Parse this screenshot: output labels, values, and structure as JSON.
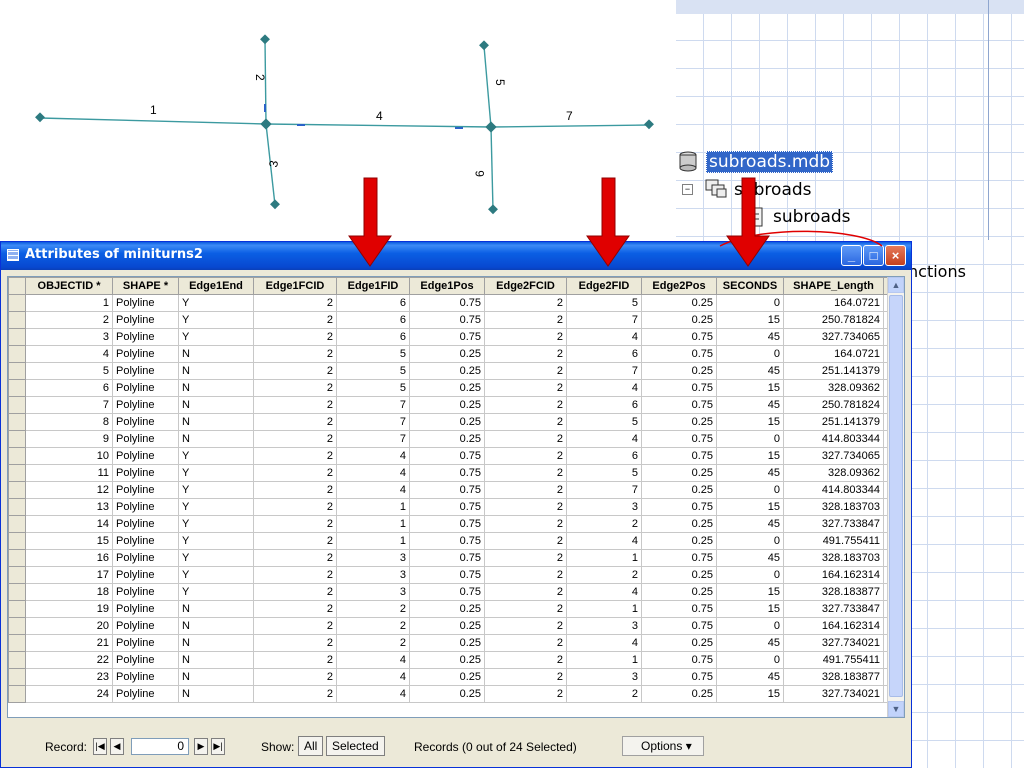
{
  "map": {
    "segment_labels": [
      "1",
      "2",
      "3",
      "4",
      "5",
      "6",
      "7"
    ]
  },
  "catalog": {
    "database": "subroads.mdb",
    "dataset": "subroads",
    "feature_class": "subroads",
    "partial_text": "nctions"
  },
  "window": {
    "title": "Attributes of miniturns2",
    "columns": [
      "OBJECTID *",
      "SHAPE *",
      "Edge1End",
      "Edge1FCID",
      "Edge1FID",
      "Edge1Pos",
      "Edge2FCID",
      "Edge2FID",
      "Edge2Pos",
      "SECONDS",
      "SHAPE_Length"
    ],
    "rows": [
      [
        "1",
        "Polyline",
        "Y",
        "2",
        "6",
        "0.75",
        "2",
        "5",
        "0.25",
        "0",
        "164.0721"
      ],
      [
        "2",
        "Polyline",
        "Y",
        "2",
        "6",
        "0.75",
        "2",
        "7",
        "0.25",
        "15",
        "250.781824"
      ],
      [
        "3",
        "Polyline",
        "Y",
        "2",
        "6",
        "0.75",
        "2",
        "4",
        "0.75",
        "45",
        "327.734065"
      ],
      [
        "4",
        "Polyline",
        "N",
        "2",
        "5",
        "0.25",
        "2",
        "6",
        "0.75",
        "0",
        "164.0721"
      ],
      [
        "5",
        "Polyline",
        "N",
        "2",
        "5",
        "0.25",
        "2",
        "7",
        "0.25",
        "45",
        "251.141379"
      ],
      [
        "6",
        "Polyline",
        "N",
        "2",
        "5",
        "0.25",
        "2",
        "4",
        "0.75",
        "15",
        "328.09362"
      ],
      [
        "7",
        "Polyline",
        "N",
        "2",
        "7",
        "0.25",
        "2",
        "6",
        "0.75",
        "45",
        "250.781824"
      ],
      [
        "8",
        "Polyline",
        "N",
        "2",
        "7",
        "0.25",
        "2",
        "5",
        "0.25",
        "15",
        "251.141379"
      ],
      [
        "9",
        "Polyline",
        "N",
        "2",
        "7",
        "0.25",
        "2",
        "4",
        "0.75",
        "0",
        "414.803344"
      ],
      [
        "10",
        "Polyline",
        "Y",
        "2",
        "4",
        "0.75",
        "2",
        "6",
        "0.75",
        "15",
        "327.734065"
      ],
      [
        "11",
        "Polyline",
        "Y",
        "2",
        "4",
        "0.75",
        "2",
        "5",
        "0.25",
        "45",
        "328.09362"
      ],
      [
        "12",
        "Polyline",
        "Y",
        "2",
        "4",
        "0.75",
        "2",
        "7",
        "0.25",
        "0",
        "414.803344"
      ],
      [
        "13",
        "Polyline",
        "Y",
        "2",
        "1",
        "0.75",
        "2",
        "3",
        "0.75",
        "15",
        "328.183703"
      ],
      [
        "14",
        "Polyline",
        "Y",
        "2",
        "1",
        "0.75",
        "2",
        "2",
        "0.25",
        "45",
        "327.733847"
      ],
      [
        "15",
        "Polyline",
        "Y",
        "2",
        "1",
        "0.75",
        "2",
        "4",
        "0.25",
        "0",
        "491.755411"
      ],
      [
        "16",
        "Polyline",
        "Y",
        "2",
        "3",
        "0.75",
        "2",
        "1",
        "0.75",
        "45",
        "328.183703"
      ],
      [
        "17",
        "Polyline",
        "Y",
        "2",
        "3",
        "0.75",
        "2",
        "2",
        "0.25",
        "0",
        "164.162314"
      ],
      [
        "18",
        "Polyline",
        "Y",
        "2",
        "3",
        "0.75",
        "2",
        "4",
        "0.25",
        "15",
        "328.183877"
      ],
      [
        "19",
        "Polyline",
        "N",
        "2",
        "2",
        "0.25",
        "2",
        "1",
        "0.75",
        "15",
        "327.733847"
      ],
      [
        "20",
        "Polyline",
        "N",
        "2",
        "2",
        "0.25",
        "2",
        "3",
        "0.75",
        "0",
        "164.162314"
      ],
      [
        "21",
        "Polyline",
        "N",
        "2",
        "2",
        "0.25",
        "2",
        "4",
        "0.25",
        "45",
        "327.734021"
      ],
      [
        "22",
        "Polyline",
        "N",
        "2",
        "4",
        "0.25",
        "2",
        "1",
        "0.75",
        "0",
        "491.755411"
      ],
      [
        "23",
        "Polyline",
        "N",
        "2",
        "4",
        "0.25",
        "2",
        "3",
        "0.75",
        "45",
        "328.183877"
      ],
      [
        "24",
        "Polyline",
        "N",
        "2",
        "4",
        "0.25",
        "2",
        "2",
        "0.25",
        "15",
        "327.734021"
      ]
    ],
    "record_label": "Record:",
    "record_value": "0",
    "show_label": "Show:",
    "show_all": "All",
    "show_selected": "Selected",
    "records_status": "Records (0 out of 24 Selected)",
    "options_label": "Options"
  },
  "colors": {
    "title_bar": "#0b5fe4",
    "arrow": "#e00000",
    "map_line": "#3c9aa0"
  },
  "icons": [
    "database-icon",
    "dataset-icon",
    "feature-class-icon",
    "table-icon",
    "minimize-icon",
    "maximize-icon",
    "close-icon",
    "arrow-down-icon"
  ]
}
